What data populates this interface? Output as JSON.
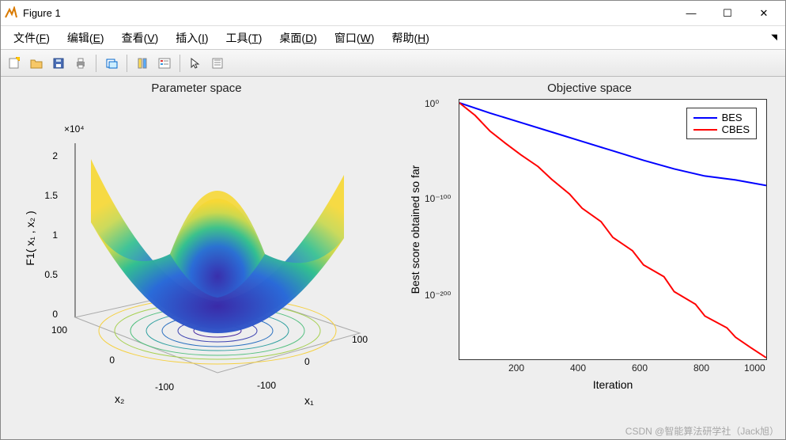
{
  "window": {
    "title": "Figure 1",
    "min": "—",
    "max": "☐",
    "close": "✕"
  },
  "menubar": {
    "items": [
      {
        "label": "文件",
        "key": "F"
      },
      {
        "label": "编辑",
        "key": "E"
      },
      {
        "label": "查看",
        "key": "V"
      },
      {
        "label": "插入",
        "key": "I"
      },
      {
        "label": "工具",
        "key": "T"
      },
      {
        "label": "桌面",
        "key": "D"
      },
      {
        "label": "窗口",
        "key": "W"
      },
      {
        "label": "帮助",
        "key": "H"
      }
    ]
  },
  "toolbar": {
    "icons": [
      "new-figure",
      "open",
      "save",
      "print",
      "gap",
      "link-axes",
      "gap",
      "insert-colorbar",
      "insert-legend",
      "gap",
      "pointer",
      "data-cursor"
    ]
  },
  "left_plot": {
    "title": "Parameter space",
    "zlabel": "F1( x₁ , x₂ )",
    "xlabel": "x₁",
    "ylabel": "x₂",
    "z_exp": "×10⁴",
    "z_ticks": [
      "0",
      "0.5",
      "1",
      "1.5",
      "2"
    ],
    "x_ticks": [
      "-100",
      "0",
      "100"
    ],
    "y_ticks": [
      "-100",
      "0",
      "100"
    ]
  },
  "right_plot": {
    "title": "Objective space",
    "xlabel": "Iteration",
    "ylabel": "Best score obtained so far",
    "x_ticks": [
      "200",
      "400",
      "600",
      "800",
      "1000"
    ],
    "y_ticks": [
      "10⁻²⁰⁰",
      "10⁻¹⁰⁰",
      "10⁰"
    ],
    "legend": [
      {
        "label": "BES",
        "color": "#0000ff"
      },
      {
        "label": "CBES",
        "color": "#ff0000"
      }
    ]
  },
  "watermark": "CSDN @智能算法研学社（Jack旭）",
  "chart_data": [
    {
      "type": "surface",
      "title": "Parameter space",
      "xlabel": "x₁",
      "ylabel": "x₂",
      "zlabel": "F1( x₁ , x₂ )",
      "xlim": [
        -100,
        100
      ],
      "ylim": [
        -100,
        100
      ],
      "zlim": [
        0,
        20000
      ],
      "z_scale": "1e4",
      "note": "F1(x1,x2)=x1^2+x2^2 style bowl surface with contour projection on floor"
    },
    {
      "type": "line",
      "title": "Objective space",
      "xlabel": "Iteration",
      "ylabel": "Best score obtained so far",
      "yscale": "log",
      "xlim": [
        0,
        1000
      ],
      "ylim": [
        1e-270,
        1.0
      ],
      "x": [
        0,
        100,
        200,
        300,
        400,
        500,
        600,
        700,
        800,
        900,
        1000
      ],
      "series": [
        {
          "name": "BES",
          "color": "#0000ff",
          "values": [
            1.0,
            1e-10,
            1e-20,
            1e-30,
            1e-40,
            1e-50,
            1e-60,
            1e-70,
            1e-75,
            1e-80,
            1e-85
          ]
        },
        {
          "name": "CBES",
          "color": "#ff0000",
          "values": [
            1.0,
            1e-30,
            1e-55,
            1e-80,
            1e-110,
            1e-140,
            1e-170,
            1e-195,
            1e-220,
            1e-245,
            1e-268
          ]
        }
      ]
    }
  ]
}
